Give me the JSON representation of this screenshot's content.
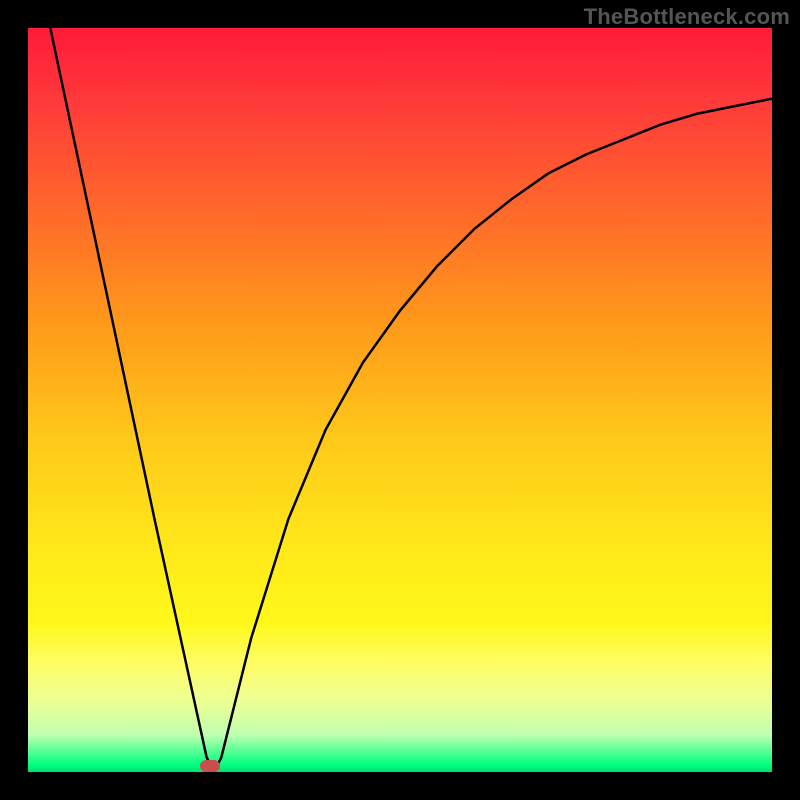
{
  "watermark": "TheBottleneck.com",
  "chart_data": {
    "type": "line",
    "title": "",
    "xlabel": "",
    "ylabel": "",
    "xlim": [
      0,
      100
    ],
    "ylim": [
      0,
      100
    ],
    "grid": false,
    "legend": false,
    "series": [
      {
        "name": "curve",
        "x": [
          3,
          10,
          17,
          24,
          25,
          26,
          30,
          35,
          40,
          45,
          50,
          55,
          60,
          65,
          70,
          75,
          80,
          85,
          90,
          95,
          100
        ],
        "values": [
          100,
          67,
          34,
          2,
          0,
          2,
          18,
          34,
          46,
          55,
          62,
          68,
          73,
          77,
          80.5,
          83,
          85,
          87,
          88.5,
          89.5,
          90.5
        ]
      }
    ],
    "marker": {
      "x": 24.5,
      "y": 0.8,
      "color": "#c94f4f"
    },
    "background_gradient": {
      "top": "#ff1a3a",
      "mid": "#ffe81a",
      "bottom": "#00e070"
    }
  }
}
